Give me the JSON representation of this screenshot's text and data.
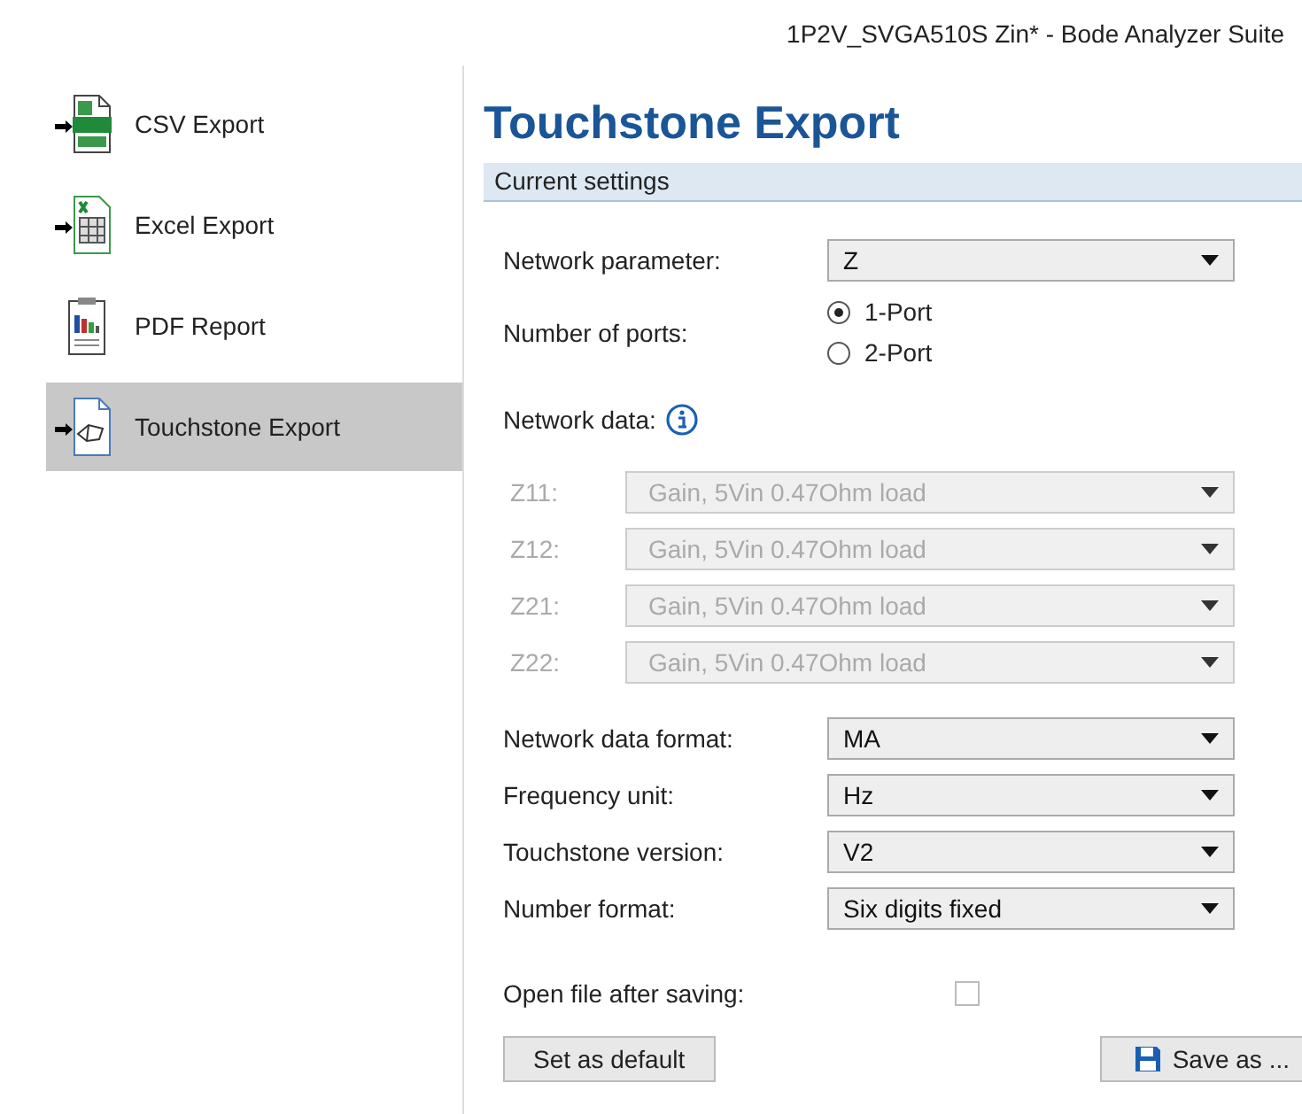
{
  "window": {
    "title": "1P2V_SVGA510S Zin* - Bode Analyzer Suite"
  },
  "sidebar": {
    "items": [
      {
        "label": "CSV Export",
        "kind": "csv",
        "selected": false
      },
      {
        "label": "Excel Export",
        "kind": "excel",
        "selected": false
      },
      {
        "label": "PDF Report",
        "kind": "pdf",
        "selected": false
      },
      {
        "label": "Touchstone Export",
        "kind": "touchstone",
        "selected": true
      }
    ]
  },
  "page_title": "Touchstone Export",
  "section_header": "Current settings",
  "network_parameter": {
    "label": "Network parameter:",
    "value": "Z",
    "disabled": false
  },
  "ports": {
    "label": "Number of ports:",
    "options": [
      {
        "label": "1-Port",
        "selected": true
      },
      {
        "label": "2-Port",
        "selected": false
      }
    ]
  },
  "network_data": {
    "label": "Network data:",
    "rows": [
      {
        "label": "Z11:",
        "value": "Gain, 5Vin 0.47Ohm load",
        "disabled": true
      },
      {
        "label": "Z12:",
        "value": "Gain, 5Vin 0.47Ohm load",
        "disabled": true
      },
      {
        "label": "Z21:",
        "value": "Gain, 5Vin 0.47Ohm load",
        "disabled": true
      },
      {
        "label": "Z22:",
        "value": "Gain, 5Vin 0.47Ohm load",
        "disabled": true
      }
    ]
  },
  "formats": [
    {
      "label": "Network data format:",
      "value": "MA",
      "disabled": false
    },
    {
      "label": "Frequency unit:",
      "value": "Hz",
      "disabled": false
    },
    {
      "label": "Touchstone version:",
      "value": "V2",
      "disabled": false
    },
    {
      "label": "Number format:",
      "value": "Six digits fixed",
      "disabled": false
    }
  ],
  "open_file": {
    "label": "Open file after saving:",
    "checked": false
  },
  "buttons": {
    "set_default": "Set as default",
    "save_as": "Save as ..."
  }
}
